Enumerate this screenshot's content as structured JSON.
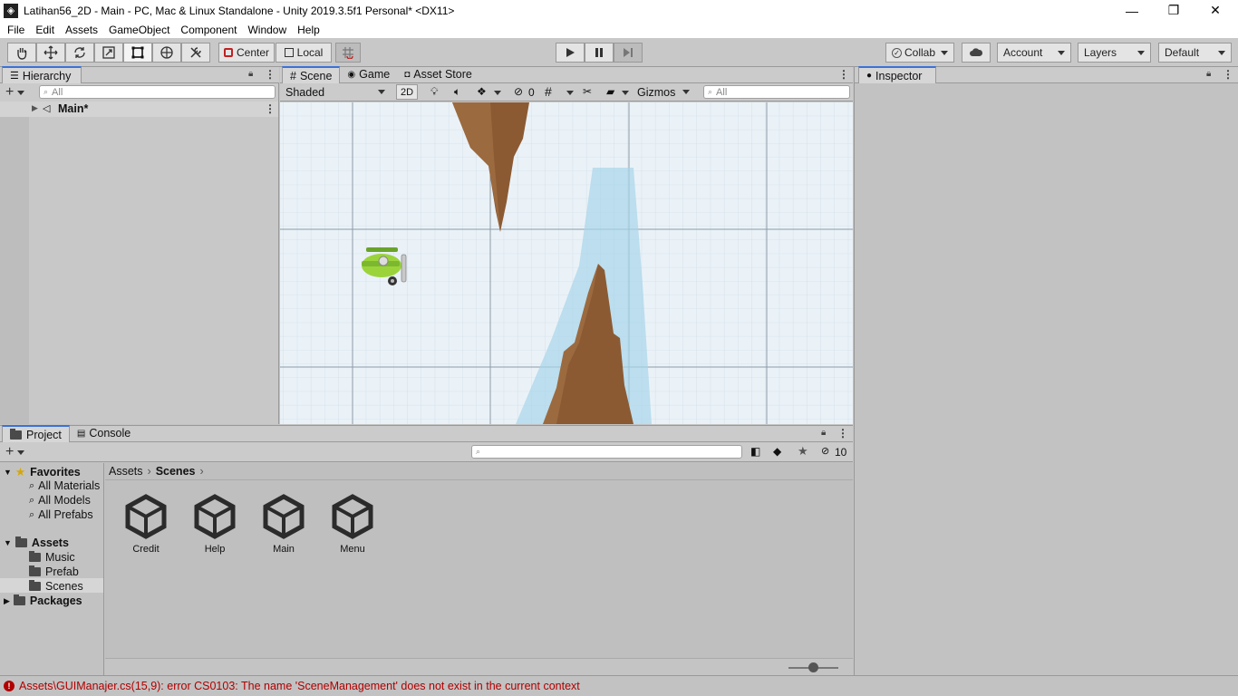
{
  "window": {
    "title": "Latihan56_2D - Main - PC, Mac & Linux Standalone - Unity 2019.3.5f1 Personal* <DX11>",
    "controls": [
      "—",
      "❐",
      "✕"
    ]
  },
  "menu": [
    "File",
    "Edit",
    "Assets",
    "GameObject",
    "Component",
    "Window",
    "Help"
  ],
  "toolbar": {
    "pivot_label": "Center",
    "space_label": "Local",
    "collab_label": "Collab",
    "account_label": "Account",
    "layers_label": "Layers",
    "layout_label": "Default"
  },
  "hierarchy": {
    "tab_label": "Hierarchy",
    "search_placeholder": "All",
    "scene_label": "Main*"
  },
  "scene_view": {
    "tabs": [
      "Scene",
      "Game",
      "Asset Store"
    ],
    "shading_mode": "Shaded",
    "mode_2d": "2D",
    "hidden_count": "0",
    "gizmos_label": "Gizmos",
    "search_placeholder": "All"
  },
  "inspector": {
    "tab_label": "Inspector"
  },
  "project": {
    "tabs": [
      "Project",
      "Console"
    ],
    "hidden_count": "10",
    "favorites_label": "Favorites",
    "favorites": [
      "All Materials",
      "All Models",
      "All Prefabs"
    ],
    "assets_label": "Assets",
    "asset_folders": [
      "Music",
      "Prefab",
      "Scenes"
    ],
    "packages_label": "Packages",
    "breadcrumb": [
      "Assets",
      "Scenes"
    ],
    "scene_assets": [
      "Credit",
      "Help",
      "Main",
      "Menu"
    ],
    "zoom_level": 0.5
  },
  "status_bar": {
    "message": "Assets\\GUIManajer.cs(15,9): error CS0103: The name 'SceneManagement' does not exist in the current context",
    "error_color": "#b00000"
  }
}
